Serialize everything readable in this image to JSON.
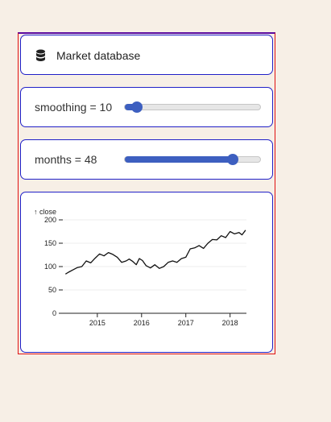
{
  "database": {
    "label": "Market database",
    "icon": "database-icon"
  },
  "smoothing": {
    "label": "smoothing = 10",
    "value": 10,
    "min": 1,
    "max": 100
  },
  "months": {
    "label": "months = 48",
    "value": 48,
    "min": 1,
    "max": 60
  },
  "colors": {
    "page_background": "#f7efe6",
    "slider_accent": "#3d5fc0",
    "card_border": "#2020c8",
    "line": "#111111"
  },
  "chart_data": {
    "type": "line",
    "ylabel": "↑ close",
    "xlabel": "",
    "ylim": [
      0,
      200
    ],
    "yticks": [
      0,
      50,
      100,
      150,
      200
    ],
    "xlim": [
      2014.22,
      2018.37
    ],
    "xticks": [
      2015,
      2016,
      2017,
      2018
    ],
    "grid": "horizontal",
    "x": [
      2014.28,
      2014.35,
      2014.45,
      2014.55,
      2014.65,
      2014.75,
      2014.85,
      2014.95,
      2015.05,
      2015.15,
      2015.25,
      2015.35,
      2015.45,
      2015.55,
      2015.65,
      2015.72,
      2015.8,
      2015.88,
      2015.95,
      2016.02,
      2016.1,
      2016.2,
      2016.3,
      2016.4,
      2016.5,
      2016.6,
      2016.7,
      2016.8,
      2016.9,
      2017.0,
      2017.1,
      2017.2,
      2017.3,
      2017.4,
      2017.5,
      2017.6,
      2017.7,
      2017.8,
      2017.9,
      2018.0,
      2018.1,
      2018.2,
      2018.27,
      2018.35
    ],
    "values": [
      84,
      88,
      93,
      98,
      100,
      112,
      108,
      118,
      127,
      123,
      130,
      126,
      120,
      109,
      112,
      116,
      111,
      104,
      117,
      113,
      102,
      97,
      104,
      96,
      100,
      109,
      112,
      109,
      117,
      120,
      138,
      140,
      145,
      139,
      150,
      158,
      157,
      166,
      162,
      175,
      170,
      173,
      168,
      178
    ]
  }
}
